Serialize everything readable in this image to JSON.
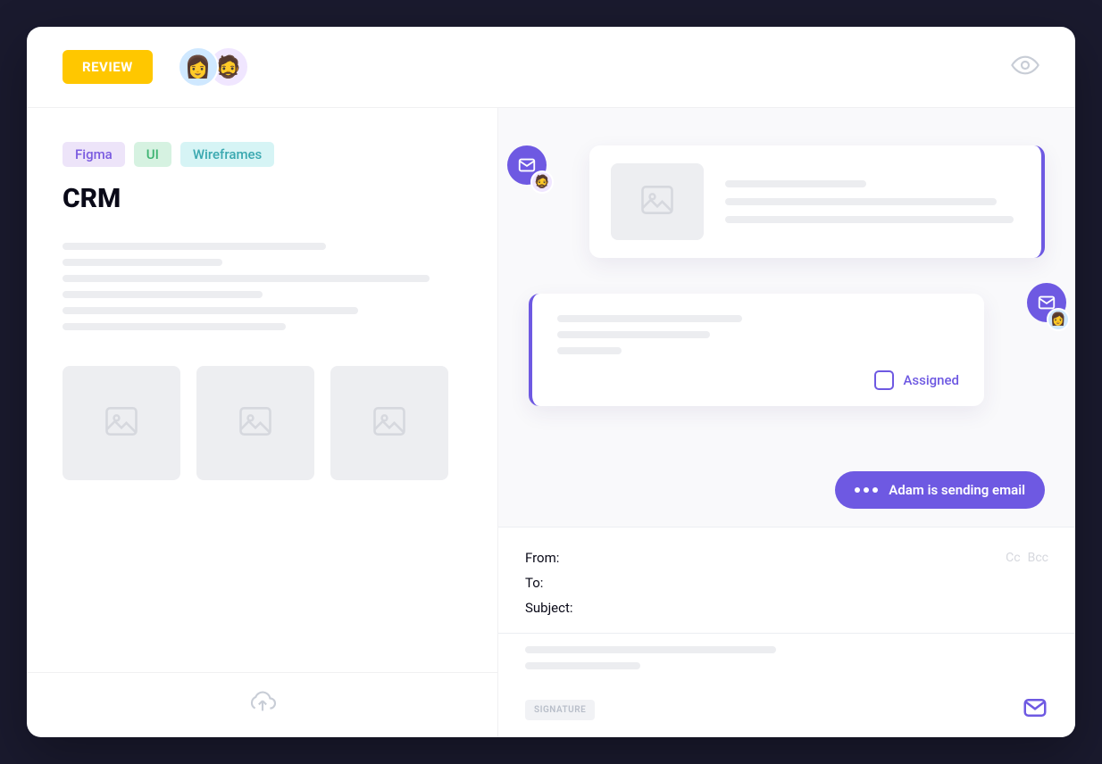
{
  "header": {
    "review_label": "REVIEW",
    "eye_icon": "eye-icon"
  },
  "left": {
    "tags": {
      "figma": "Figma",
      "ui": "UI",
      "wireframes": "Wireframes"
    },
    "title": "CRM",
    "upload_icon": "cloud-upload-icon"
  },
  "right": {
    "assigned_label": "Assigned",
    "status_text": "Adam is sending email",
    "mail_icon": "mail-icon"
  },
  "compose": {
    "from_label": "From:",
    "to_label": "To:",
    "subject_label": "Subject:",
    "cc_label": "Cc",
    "bcc_label": "Bcc",
    "signature_label": "SIGNATURE",
    "send_icon": "mail-icon"
  }
}
